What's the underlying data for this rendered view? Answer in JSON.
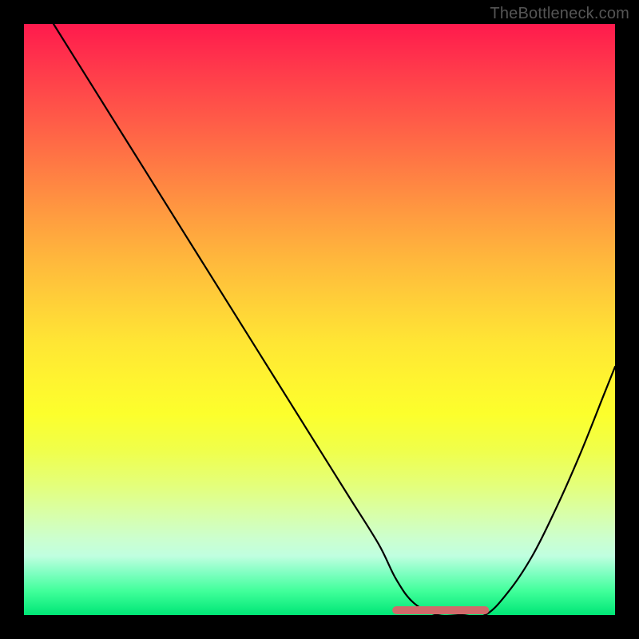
{
  "watermark": "TheBottleneck.com",
  "chart_data": {
    "type": "line",
    "title": "",
    "xlabel": "",
    "ylabel": "",
    "xlim": [
      0,
      100
    ],
    "ylim": [
      0,
      100
    ],
    "grid": false,
    "series": [
      {
        "name": "bottleneck-curve",
        "x": [
          5,
          10,
          15,
          20,
          25,
          30,
          35,
          40,
          45,
          50,
          55,
          60,
          63,
          66,
          70,
          74,
          78,
          82,
          86,
          90,
          94,
          98,
          100
        ],
        "values": [
          100,
          92,
          84,
          76,
          68,
          60,
          52,
          44,
          36,
          28,
          20,
          12,
          6,
          2,
          0,
          0,
          0,
          4,
          10,
          18,
          27,
          37,
          42
        ]
      },
      {
        "name": "optimal-flat-segment",
        "x": [
          63,
          78
        ],
        "values": [
          0,
          0
        ]
      }
    ],
    "colors": {
      "curve": "#000000",
      "optimal_segment": "#d06a6a",
      "gradient_top": "#ff1a4d",
      "gradient_mid": "#ffe634",
      "gradient_bottom": "#00e676"
    }
  }
}
